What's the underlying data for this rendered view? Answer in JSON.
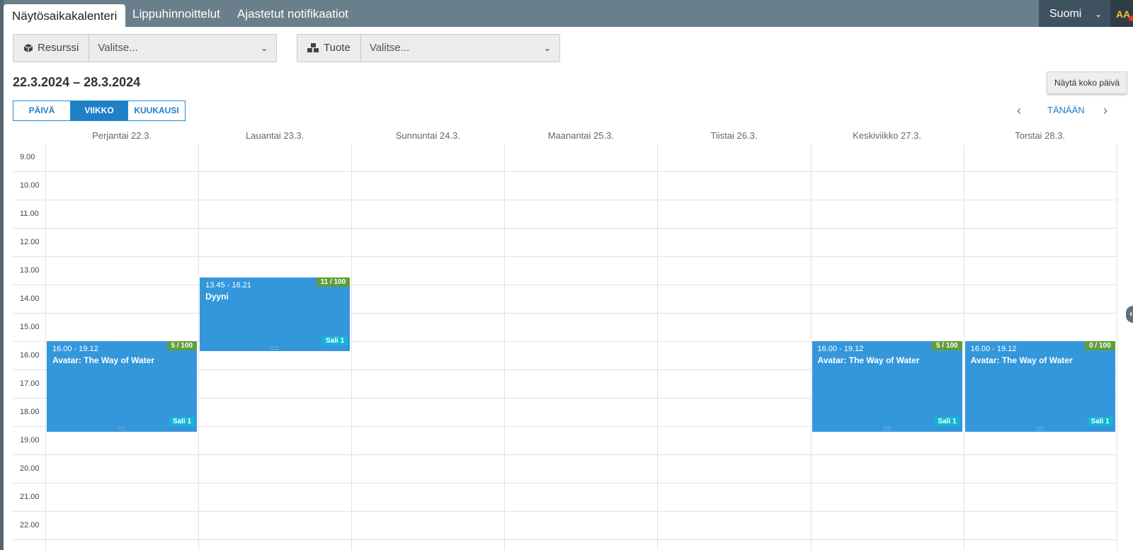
{
  "tabs": [
    "Näytösaikakalenteri",
    "Lippuhinnoittelut",
    "Ajastetut notifikaatiot"
  ],
  "language": {
    "label": "Suomi",
    "icon": "chevron-down-icon"
  },
  "accessibility": {
    "label": "AA"
  },
  "filters": {
    "resource": {
      "label": "Resurssi",
      "icon": "cube-icon",
      "placeholder": "Valitse..."
    },
    "product": {
      "label": "Tuote",
      "icon": "cubes-icon",
      "placeholder": "Valitse..."
    }
  },
  "date_range": "22.3.2024 – 28.3.2024",
  "show_full_day": "Näytä koko päivä",
  "view_buttons": [
    "PÄIVÄ",
    "VIIKKO",
    "KUUKAUSI"
  ],
  "active_view": "VIIKKO",
  "nav": {
    "prev_icon": "chevron-left-icon",
    "today": "TÄNÄÄN",
    "next_icon": "chevron-right-icon"
  },
  "days": [
    "Perjantai 22.3.",
    "Lauantai 23.3.",
    "Sunnuntai 24.3.",
    "Maanantai 25.3.",
    "Tiistai 26.3.",
    "Keskiviikko 27.3.",
    "Torstai 28.3."
  ],
  "hours": [
    "9.00",
    "10.00",
    "11.00",
    "12.00",
    "13.00",
    "14.00",
    "15.00",
    "16.00",
    "17.00",
    "18.00",
    "19.00",
    "20.00",
    "21.00",
    "22.00"
  ],
  "events": [
    {
      "day": 0,
      "time": "16.00 - 19.12",
      "title": "Avatar: The Way of Water",
      "capacity": "5 / 100",
      "room": "Sali 1",
      "start_h": 16.0,
      "end_h": 19.2
    },
    {
      "day": 1,
      "time": "13.45 - 16.21",
      "title": "Dyyni",
      "capacity": "11 / 100",
      "room": "Sali 1",
      "start_h": 13.75,
      "end_h": 16.35
    },
    {
      "day": 5,
      "time": "16.00 - 19.12",
      "title": "Avatar: The Way of Water",
      "capacity": "5 / 100",
      "room": "Sali 1",
      "start_h": 16.0,
      "end_h": 19.2
    },
    {
      "day": 6,
      "time": "16.00 - 19.12",
      "title": "Avatar: The Way of Water",
      "capacity": "0 / 100",
      "room": "Sali 1",
      "start_h": 16.0,
      "end_h": 19.2
    }
  ],
  "colors": {
    "event": "#3497dc",
    "capacity": "#5f9e3a",
    "room": "#13b6d8",
    "accent": "#1f7fc7",
    "nav": "#6a7f8c"
  }
}
